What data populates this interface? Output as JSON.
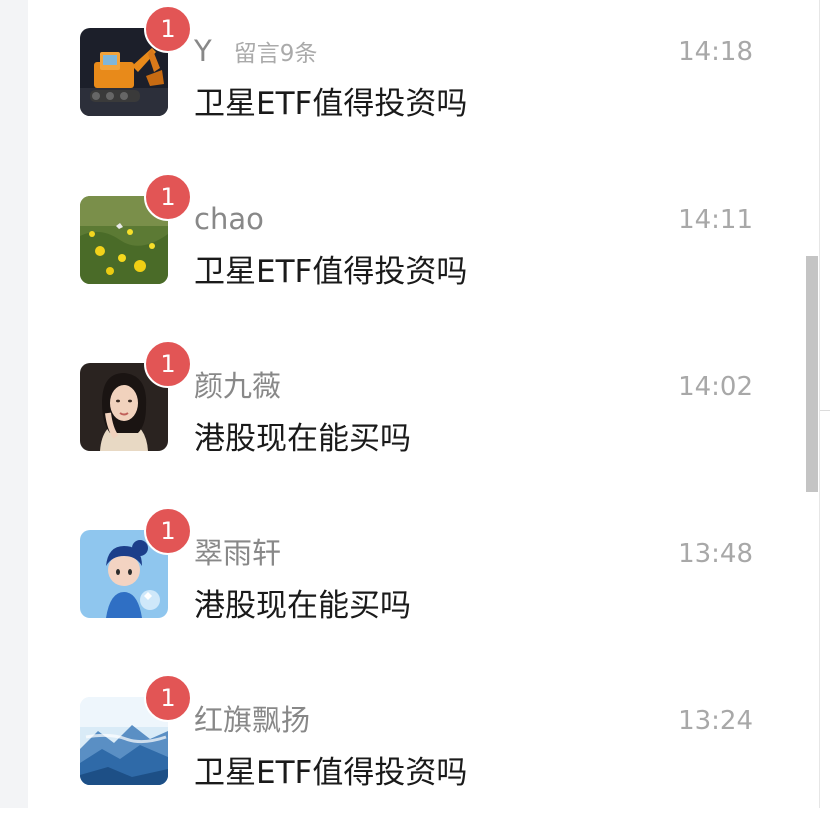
{
  "conversations": [
    {
      "name": "Y",
      "note": "留言9条",
      "time": "14:18",
      "message": "卫星ETF值得投资吗",
      "unread": "1",
      "avatar_icon": "excavator-avatar-icon"
    },
    {
      "name": "chao",
      "time": "14:11",
      "message": "卫星ETF值得投资吗",
      "unread": "1",
      "avatar_icon": "flower-field-avatar-icon"
    },
    {
      "name": "颜九薇",
      "time": "14:02",
      "message": "港股现在能买吗",
      "unread": "1",
      "avatar_icon": "woman-portrait-avatar-icon"
    },
    {
      "name": "翠雨轩",
      "time": "13:48",
      "message": "港股现在能买吗",
      "unread": "1",
      "avatar_icon": "cartoon-girl-avatar-icon"
    },
    {
      "name": "红旗飘扬",
      "time": "13:24",
      "message": "卫星ETF值得投资吗",
      "unread": "1",
      "avatar_icon": "mountain-avatar-icon"
    }
  ],
  "colors": {
    "badge": "#e25555",
    "name": "#888888",
    "time": "#a8a8a8",
    "message": "#1a1a1a"
  }
}
